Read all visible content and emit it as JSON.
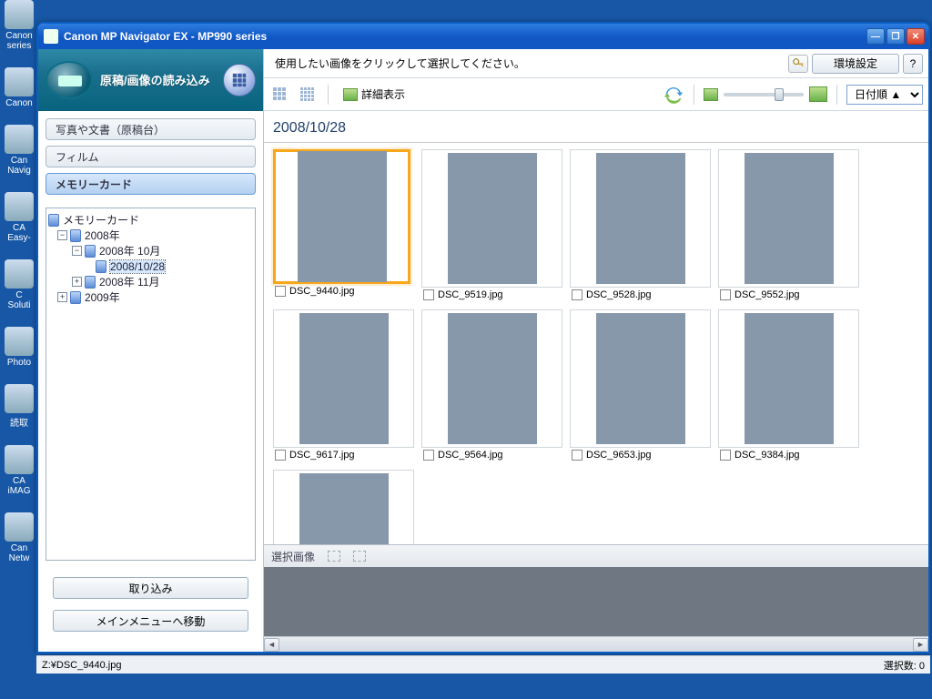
{
  "desktop": {
    "icons": [
      "Canon series",
      "Canon",
      "Can Navig",
      "CA Easy-",
      "C Soluti",
      "Photo",
      "読取",
      "CA iMAG",
      "Can Netw"
    ]
  },
  "window": {
    "title": "Canon MP Navigator EX - MP990 series"
  },
  "sidebar": {
    "header": "原稿/画像の読み込み",
    "tabs": [
      "写真や文書（原稿台）",
      "フィルム",
      "メモリーカード"
    ],
    "active_tab": 2,
    "tree": {
      "root": "メモリーカード",
      "y2008": "2008年",
      "oct": "2008年 10月",
      "date": "2008/10/28",
      "nov": "2008年 11月",
      "y2009": "2009年"
    },
    "import_btn": "取り込み",
    "mainmenu_btn": "メインメニューへ移動"
  },
  "topbar": {
    "instruction": "使用したい画像をクリックして選択してください。",
    "prefs": "環境設定",
    "help": "?"
  },
  "toolbar": {
    "detail": "詳細表示",
    "sort": "日付順 ▲"
  },
  "content": {
    "date_header": "2008/10/28",
    "thumbs": [
      {
        "file": "DSC_9440.jpg",
        "cls": "p1",
        "sel": true
      },
      {
        "file": "DSC_9519.jpg",
        "cls": "p2"
      },
      {
        "file": "DSC_9528.jpg",
        "cls": "p3"
      },
      {
        "file": "DSC_9552.jpg",
        "cls": "p4"
      },
      {
        "file": "DSC_9617.jpg",
        "cls": "p5"
      },
      {
        "file": "DSC_9564.jpg",
        "cls": "p6"
      },
      {
        "file": "DSC_9653.jpg",
        "cls": "p7"
      },
      {
        "file": "DSC_9384.jpg",
        "cls": "p8"
      },
      {
        "file": "",
        "cls": "p9"
      }
    ]
  },
  "selection": {
    "label": "選択画像"
  },
  "status": {
    "path": "Z:¥DSC_9440.jpg",
    "count_label": "選択数: 0"
  }
}
